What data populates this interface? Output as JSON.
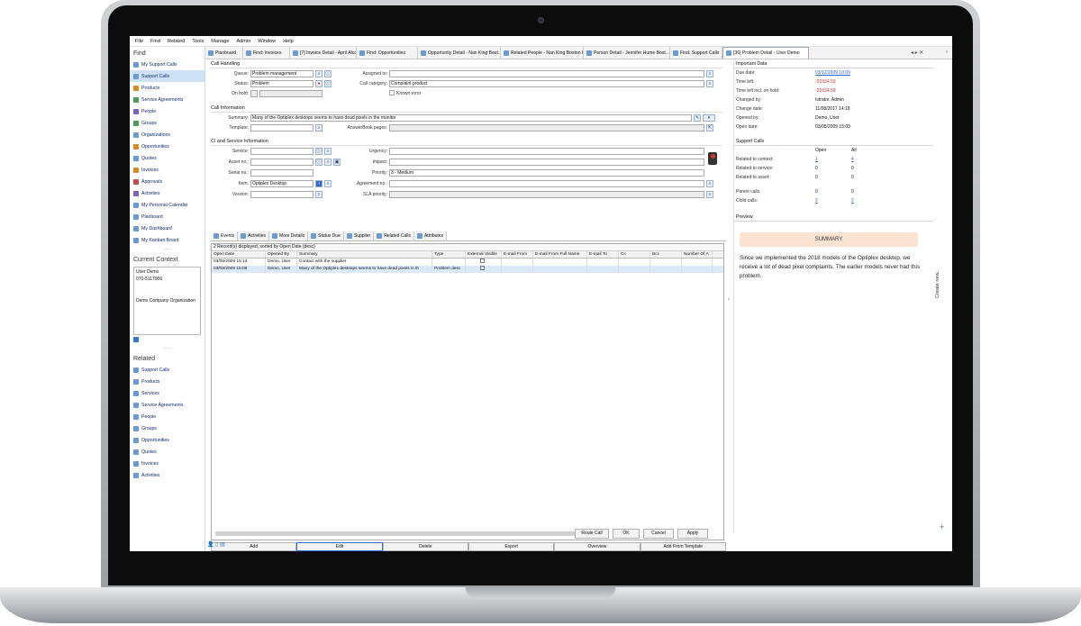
{
  "menu": [
    "File",
    "Find",
    "Related",
    "Tools",
    "Manage",
    "Admin",
    "Window",
    "Help"
  ],
  "sidebar": {
    "find_title": "Find",
    "find_items": [
      {
        "label": "My Support Calls",
        "icon": "support-call-icon"
      },
      {
        "label": "Support Calls",
        "icon": "support-call-icon",
        "selected": true
      },
      {
        "label": "Products",
        "icon": "product-icon"
      },
      {
        "label": "Service Agreements",
        "icon": "agreement-icon"
      },
      {
        "label": "People",
        "icon": "person-icon"
      },
      {
        "label": "Groups",
        "icon": "group-icon"
      },
      {
        "label": "Organizations",
        "icon": "organization-icon"
      },
      {
        "label": "Opportunities",
        "icon": "opportunity-icon"
      },
      {
        "label": "Quotes",
        "icon": "quote-icon"
      },
      {
        "label": "Invoices",
        "icon": "invoice-icon"
      },
      {
        "label": "Approvals",
        "icon": "approval-icon"
      },
      {
        "label": "Activities",
        "icon": "activity-icon"
      },
      {
        "label": "My Personal Calendar",
        "icon": "calendar-icon"
      },
      {
        "label": "Planboard",
        "icon": "planboard-icon"
      },
      {
        "label": "My Dashboard",
        "icon": "dashboard-icon"
      },
      {
        "label": "My Kanban Board",
        "icon": "kanban-icon"
      }
    ],
    "context_title": "Current Context",
    "context_lines": [
      "User Demo",
      "070-5117006",
      "",
      "",
      "Demo Company Organization"
    ],
    "related_title": "Related",
    "related_items": [
      {
        "label": "Support Calls"
      },
      {
        "label": "Products"
      },
      {
        "label": "Services"
      },
      {
        "label": "Service Agreements"
      },
      {
        "label": "People"
      },
      {
        "label": "Groups"
      },
      {
        "label": "Opportunities"
      },
      {
        "label": "Quotes"
      },
      {
        "label": "Invoices"
      },
      {
        "label": "Activities"
      }
    ]
  },
  "tabs": [
    {
      "label": "Planboard"
    },
    {
      "label": "Find: Invoices"
    },
    {
      "label": "[7] Invoice Detail - April Alcott ..."
    },
    {
      "label": "Find: Opportunities"
    },
    {
      "label": "Opportunity Detail - Nan King Bost..."
    },
    {
      "label": "Related People - Nan King Boston F..."
    },
    {
      "label": "Person Detail - Jennifer Hume Bost..."
    },
    {
      "label": "Find: Support Calls"
    },
    {
      "label": "[36] Problem Detail - User Demo",
      "active": true
    }
  ],
  "form": {
    "call_handling": "Call Handling",
    "queue_label": "Queue:",
    "queue": "Problem management",
    "status_label": "Status:",
    "status": "Problem",
    "onhold_label": "On hold:",
    "assignedto_label": "Assigned to:",
    "assignedto": "",
    "category_label": "Call category:",
    "category": "Complaint product",
    "known_error": "Known error",
    "call_info": "Call Information",
    "summary_label": "Summary:",
    "summary": "Many of the Optiplex desktops seems to have dead pixels in the monitor",
    "template_label": "Template:",
    "template": "",
    "answerbook_label": "AnswerBook pages:",
    "ci_service": "CI and Service Information",
    "service_label": "Service:",
    "asset_label": "Asset no.:",
    "serial_label": "Serial no.:",
    "item_label": "Item:",
    "item": "Optiplex Desktop",
    "version_label": "Version:",
    "urgency_label": "Urgency:",
    "impact_label": "Impact:",
    "priority_label": "Priority:",
    "priority": "3 - Medium",
    "agreement_label": "Agreement no.:",
    "sla_label": "SLA priority:"
  },
  "subtabs": [
    "Events",
    "Activities",
    "More Details",
    "Status Due",
    "Supplier",
    "Related Calls",
    "Attributes"
  ],
  "grid": {
    "info": "2 Record(s) displayed, sorted by Open Date (desc)",
    "columns": [
      "Open Date",
      "Opened By",
      "Summary",
      "Type",
      "External Visible",
      "E-mail From",
      "E-mail From Full Name",
      "E-mail To",
      "Cc",
      "Bcc",
      "Number Of A"
    ],
    "rows": [
      [
        "03/05/2009 15:13",
        "Demo, User",
        "Contact with the supplier",
        "",
        "",
        "",
        "",
        "",
        "",
        "",
        ""
      ],
      [
        "03/05/2009 15:09",
        "Demo, User",
        "Many of the Optiplex desktops seems to have dead pixels in th",
        "Problem desc",
        "",
        "",
        "",
        "",
        "",
        "",
        ""
      ]
    ]
  },
  "grid_buttons": [
    "Add",
    "Edit",
    "Delete",
    "Export",
    "Overview",
    "Add From Template"
  ],
  "dialog_buttons": [
    "Route Call",
    "OK",
    "Cancel",
    "Apply"
  ],
  "right": {
    "important_title": "Important Data",
    "important": [
      {
        "k": "Due date:",
        "v": "03/12/2009 10:09",
        "style": "link"
      },
      {
        "k": "Time left:",
        "v": "-20334:59",
        "style": "red"
      },
      {
        "k": "Time left incl. on hold:",
        "v": "-20334:59",
        "style": "red"
      },
      {
        "k": "Changed by:",
        "v": "Istrator, Admin",
        "style": ""
      },
      {
        "k": "Change date:",
        "v": "11/08/2017 14:18",
        "style": ""
      },
      {
        "k": "Opened by:",
        "v": "Demo, User",
        "style": ""
      },
      {
        "k": "Open date:",
        "v": "03/05/2009 15:09",
        "style": ""
      }
    ],
    "support_title": "Support Calls",
    "support_hdr": [
      "Open",
      "All"
    ],
    "support_rows": [
      {
        "k": "Related to context:",
        "open": "1",
        "all": "4",
        "link": true
      },
      {
        "k": "Related to service:",
        "open": "0",
        "all": "0"
      },
      {
        "k": "Related to asset:",
        "open": "0",
        "all": "0"
      },
      {
        "k": "Parent calls:",
        "open": "0",
        "all": "0"
      },
      {
        "k": "Child calls:",
        "open": "2",
        "all": "2",
        "link": true
      }
    ],
    "preview_title": "Preview",
    "summary_heading": "SUMMARY",
    "summary_text": "Since we implemented the 2018 models of the Optiplex desktop, we receive a lot of dead pixel complaints. The earlier models never had this problem.",
    "create_new": "Create new..."
  }
}
